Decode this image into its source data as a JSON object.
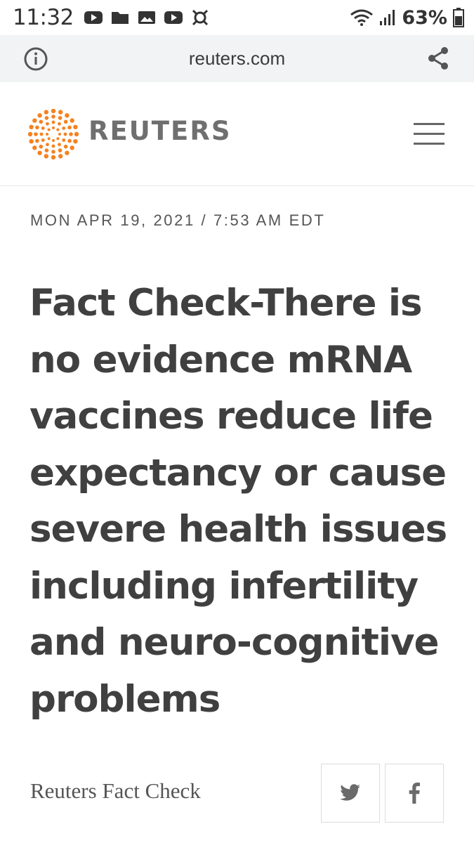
{
  "status_bar": {
    "time": "11:32",
    "battery": "63%",
    "icons_left": [
      "youtube-icon",
      "folder-icon",
      "image-icon",
      "youtube-icon",
      "app-icon"
    ],
    "icons_right": [
      "wifi-icon",
      "signal-icon",
      "battery-icon"
    ]
  },
  "url_bar": {
    "url": "reuters.com",
    "icons": [
      "info-icon",
      "share-icon"
    ]
  },
  "header": {
    "logo_text": "REUTERS",
    "brand_color": "#f58220",
    "menu_icon": "hamburger-menu-icon"
  },
  "article": {
    "dateline": "MON APR 19, 2021 / 7:53 AM EDT",
    "headline_lines": [
      "Fact Check-There is",
      "no evidence mRNA",
      "vaccines reduce life",
      "expectancy or cause",
      "severe health issues",
      "including infertility",
      "and neuro-cognitive",
      "problems"
    ],
    "byline": "Reuters Fact Check",
    "share_icons": [
      "twitter-icon",
      "facebook-icon"
    ]
  }
}
